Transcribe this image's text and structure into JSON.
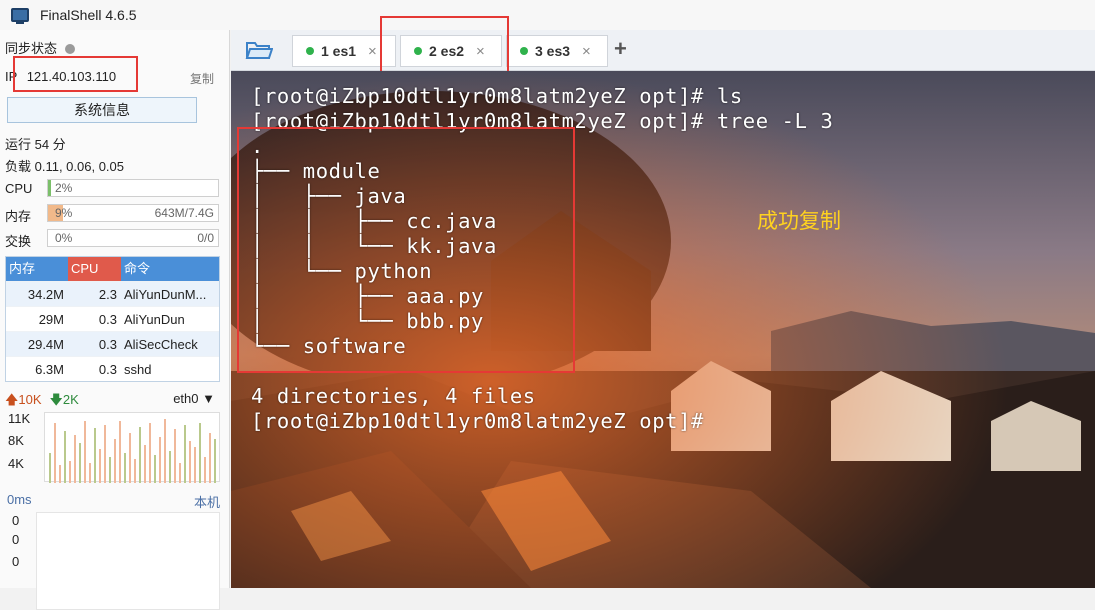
{
  "window": {
    "title": "FinalShell 4.6.5"
  },
  "sidebar": {
    "sync_label": "同步状态",
    "ip_label": "IP",
    "ip_value": "121.40.103.110",
    "copy_label": "复制",
    "sysinfo_button": "系统信息",
    "uptime": "运行 54 分",
    "load": "负载 0.11, 0.06, 0.05",
    "cpu": {
      "label": "CPU",
      "pct_text": "2%",
      "fraction": 0.02,
      "color": "#7bbf6a"
    },
    "mem": {
      "label": "内存",
      "pct_text": "9%",
      "fraction": 0.09,
      "right": "643M/7.4G",
      "color": "#f1b98a"
    },
    "swap": {
      "label": "交换",
      "pct_text": "0%",
      "fraction": 0.0,
      "right": "0/0"
    },
    "process_table": {
      "headers": {
        "mem": "内存",
        "cpu": "CPU",
        "cmd": "命令"
      },
      "rows": [
        {
          "mem": "34.2M",
          "cpu": "2.3",
          "cmd": "AliYunDunM..."
        },
        {
          "mem": "29M",
          "cpu": "0.3",
          "cmd": "AliYunDun"
        },
        {
          "mem": "29.4M",
          "cpu": "0.3",
          "cmd": "AliSecCheck"
        },
        {
          "mem": "6.3M",
          "cpu": "0.3",
          "cmd": "sshd"
        }
      ]
    },
    "network": {
      "up": "10K",
      "down": "2K",
      "interface": "eth0",
      "y_labels": [
        "11K",
        "8K",
        "4K"
      ]
    },
    "ping": {
      "label": "0ms",
      "host": "本机",
      "y_labels": [
        "0",
        "0",
        "0"
      ]
    }
  },
  "tabs": [
    {
      "label": "1 es1",
      "close": "×"
    },
    {
      "label": "2 es2",
      "close": "×"
    },
    {
      "label": "3 es3",
      "close": "×"
    }
  ],
  "add_tab": "+",
  "terminal": {
    "lines": [
      "[root@iZbp10dtl1yr0m8latm2yeZ opt]# ls",
      "[root@iZbp10dtl1yr0m8latm2yeZ opt]# tree -L 3",
      ".",
      "├── module",
      "│   ├── java",
      "│   │   ├── cc.java",
      "│   │   └── kk.java",
      "│   └── python",
      "│       ├── aaa.py",
      "│       └── bbb.py",
      "└── software",
      "",
      "4 directories, 4 files",
      "[root@iZbp10dtl1yr0m8latm2yeZ opt]#"
    ],
    "annotation": "成功复制"
  }
}
